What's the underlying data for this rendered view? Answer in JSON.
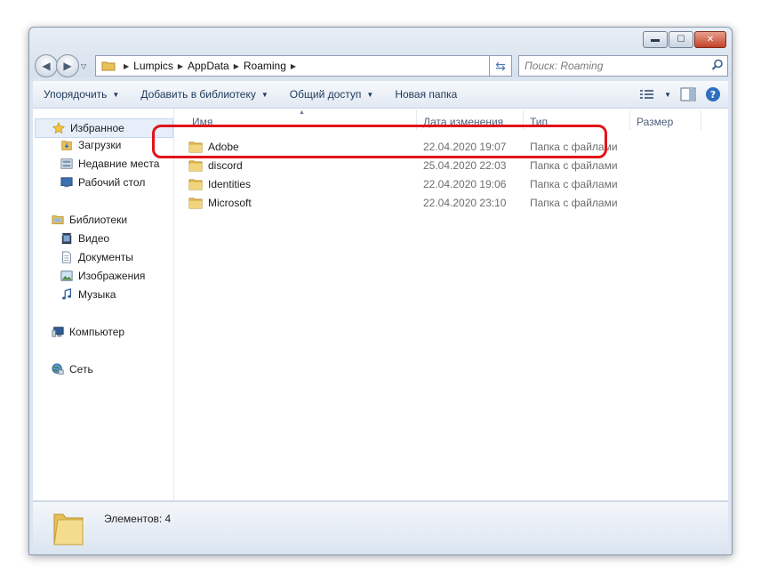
{
  "window": {
    "caption": {
      "minimize": "▬",
      "maximize": "☐",
      "close": "✕"
    }
  },
  "address": {
    "path": [
      "Lumpics",
      "AppData",
      "Roaming"
    ],
    "search_placeholder": "Поиск: Roaming"
  },
  "toolbar": {
    "organize": "Упорядочить",
    "add_to_library": "Добавить в библиотеку",
    "share": "Общий доступ",
    "new_folder": "Новая папка"
  },
  "nav": {
    "favorites": {
      "label": "Избранное",
      "items": [
        "Загрузки",
        "Недавние места",
        "Рабочий стол"
      ]
    },
    "libraries": {
      "label": "Библиотеки",
      "items": [
        "Видео",
        "Документы",
        "Изображения",
        "Музыка"
      ]
    },
    "computer": "Компьютер",
    "network": "Сеть"
  },
  "columns": {
    "name": "Имя",
    "date": "Дата изменения",
    "type": "Тип",
    "size": "Размер"
  },
  "files": [
    {
      "name": "Adobe",
      "date": "22.04.2020 19:07",
      "type": "Папка с файлами"
    },
    {
      "name": "discord",
      "date": "25.04.2020 22:03",
      "type": "Папка с файлами"
    },
    {
      "name": "Identities",
      "date": "22.04.2020 19:06",
      "type": "Папка с файлами"
    },
    {
      "name": "Microsoft",
      "date": "22.04.2020 23:10",
      "type": "Папка с файлами"
    }
  ],
  "status": {
    "items_count": "Элементов: 4"
  },
  "colors": {
    "highlight": "#e0141a",
    "folder": "#e8c15a",
    "toolbar_text": "#1e395b"
  }
}
